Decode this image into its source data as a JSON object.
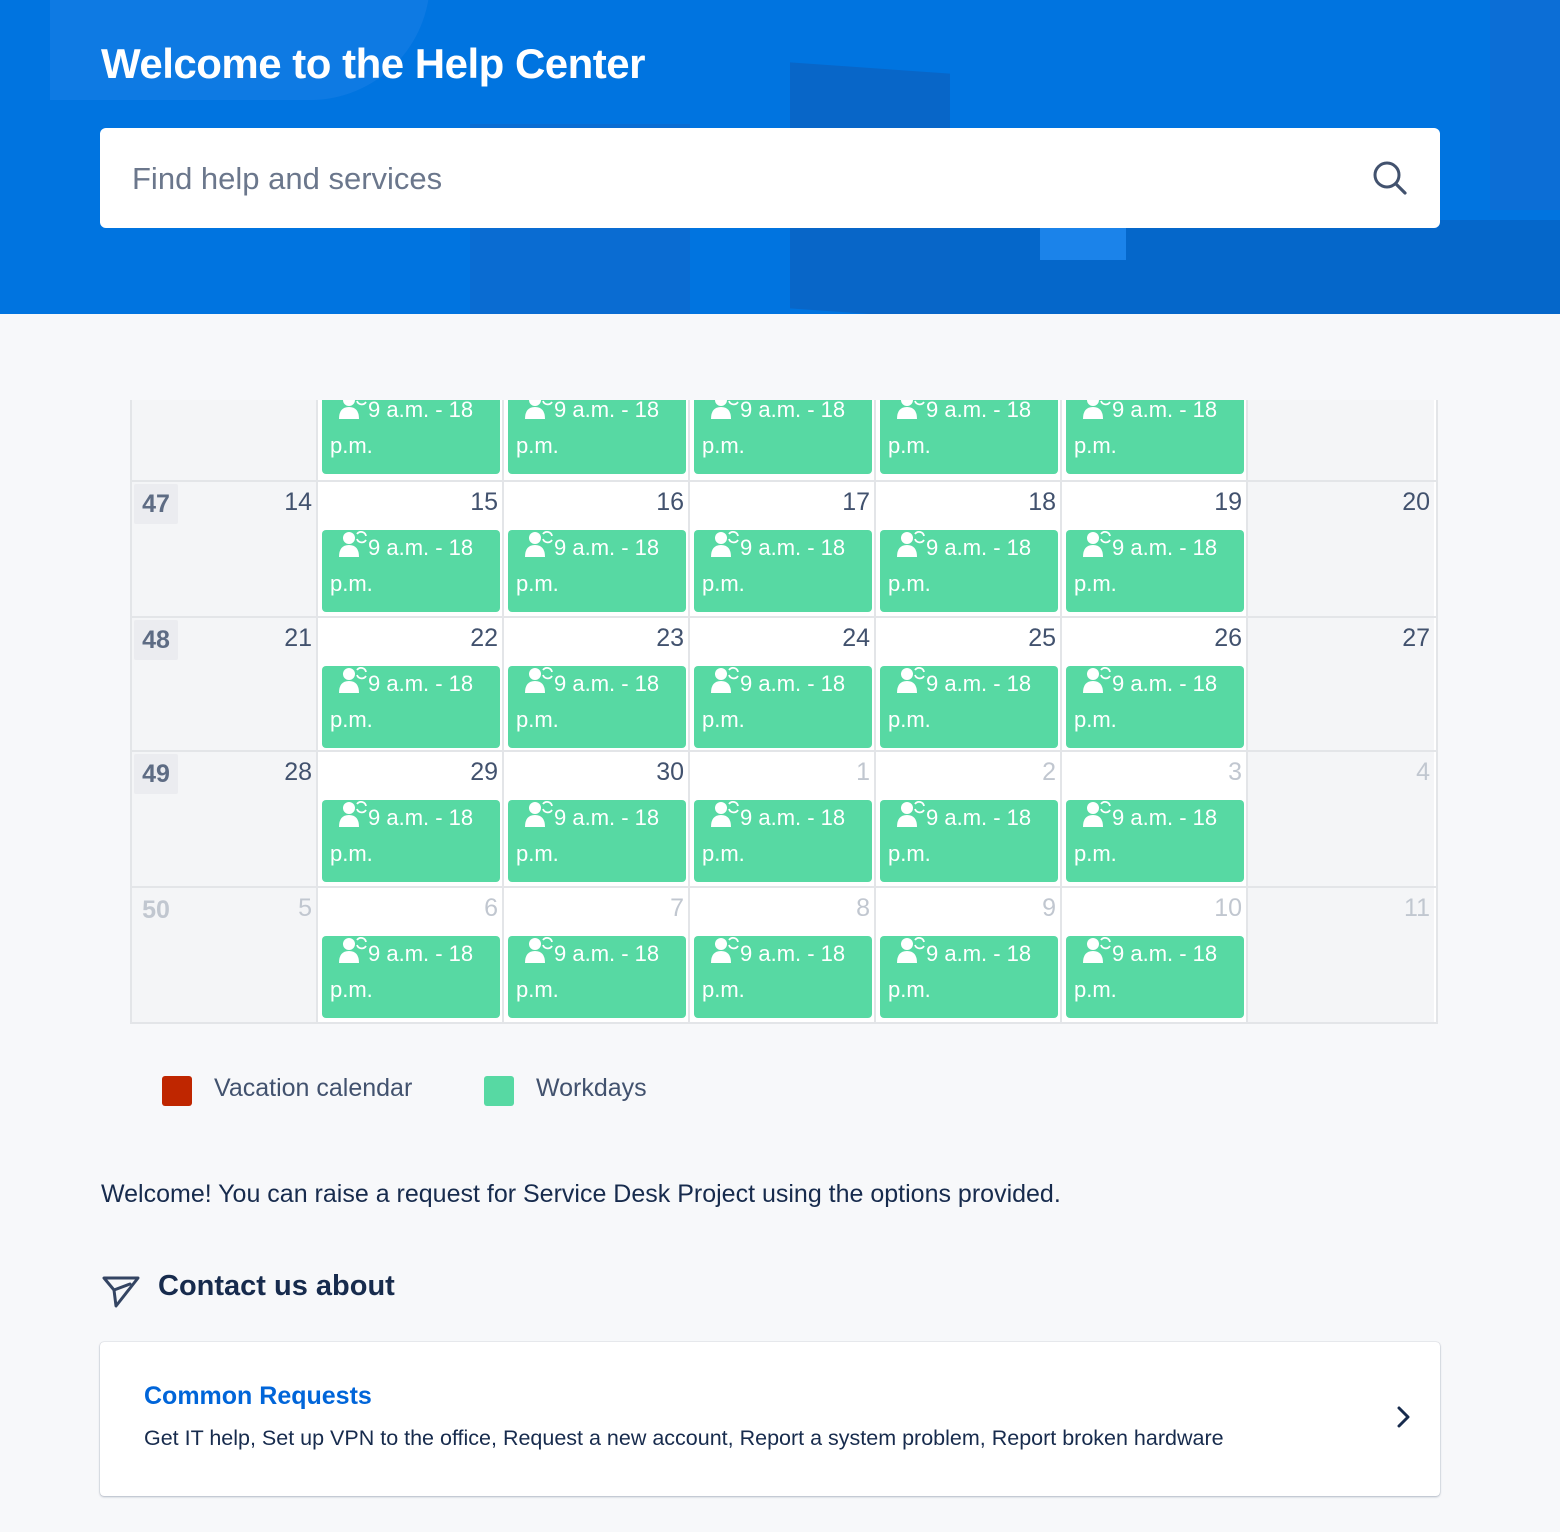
{
  "header": {
    "title": "Welcome to the Help Center",
    "search_placeholder": "Find help and services"
  },
  "colors": {
    "banner": "#0074e0",
    "workday": "#57d9a3",
    "vacation": "#bf2600",
    "link": "#0065d9"
  },
  "calendar": {
    "event_label_line1": "9 a.m. - 18",
    "event_label_line2": "p.m.",
    "event_icon": "user-sync-icon",
    "partial_row": {
      "days": [
        {
          "num": "",
          "event": false,
          "weekend": true
        },
        {
          "num": "",
          "event": true
        },
        {
          "num": "",
          "event": true
        },
        {
          "num": "",
          "event": true
        },
        {
          "num": "",
          "event": true
        },
        {
          "num": "",
          "event": true
        },
        {
          "num": "",
          "event": false,
          "weekend": true
        }
      ]
    },
    "weeks": [
      {
        "week": "47",
        "other": false,
        "days": [
          {
            "num": "14",
            "other": false,
            "event": false,
            "weekend": true
          },
          {
            "num": "15",
            "other": false,
            "event": true
          },
          {
            "num": "16",
            "other": false,
            "event": true
          },
          {
            "num": "17",
            "other": false,
            "event": true
          },
          {
            "num": "18",
            "other": false,
            "event": true
          },
          {
            "num": "19",
            "other": false,
            "event": true
          },
          {
            "num": "20",
            "other": false,
            "event": false,
            "weekend": true
          }
        ]
      },
      {
        "week": "48",
        "other": false,
        "days": [
          {
            "num": "21",
            "other": false,
            "event": false,
            "weekend": true
          },
          {
            "num": "22",
            "other": false,
            "event": true
          },
          {
            "num": "23",
            "other": false,
            "event": true
          },
          {
            "num": "24",
            "other": false,
            "event": true
          },
          {
            "num": "25",
            "other": false,
            "event": true
          },
          {
            "num": "26",
            "other": false,
            "event": true
          },
          {
            "num": "27",
            "other": false,
            "event": false,
            "weekend": true
          }
        ]
      },
      {
        "week": "49",
        "other": false,
        "days": [
          {
            "num": "28",
            "other": false,
            "event": false,
            "weekend": true
          },
          {
            "num": "29",
            "other": false,
            "event": true
          },
          {
            "num": "30",
            "other": false,
            "event": true
          },
          {
            "num": "1",
            "other": true,
            "event": true
          },
          {
            "num": "2",
            "other": true,
            "event": true
          },
          {
            "num": "3",
            "other": true,
            "event": true
          },
          {
            "num": "4",
            "other": true,
            "event": false,
            "weekend": true
          }
        ]
      },
      {
        "week": "50",
        "other": true,
        "days": [
          {
            "num": "5",
            "other": true,
            "event": false,
            "weekend": true
          },
          {
            "num": "6",
            "other": true,
            "event": true
          },
          {
            "num": "7",
            "other": true,
            "event": true
          },
          {
            "num": "8",
            "other": true,
            "event": true
          },
          {
            "num": "9",
            "other": true,
            "event": true
          },
          {
            "num": "10",
            "other": true,
            "event": true
          },
          {
            "num": "11",
            "other": true,
            "event": false,
            "weekend": true
          }
        ]
      }
    ]
  },
  "legend": [
    {
      "label": "Vacation calendar",
      "color": "#bf2600"
    },
    {
      "label": "Workdays",
      "color": "#57d9a3"
    }
  ],
  "welcome_text": "Welcome! You can raise a request for Service Desk Project using the options provided.",
  "contact": {
    "heading": "Contact us about",
    "icon": "send-icon",
    "card": {
      "title": "Common Requests",
      "description": "Get IT help, Set up VPN to the office, Request a new account, Report a system problem, Report broken hardware",
      "chevron": "chevron-right-icon"
    }
  }
}
